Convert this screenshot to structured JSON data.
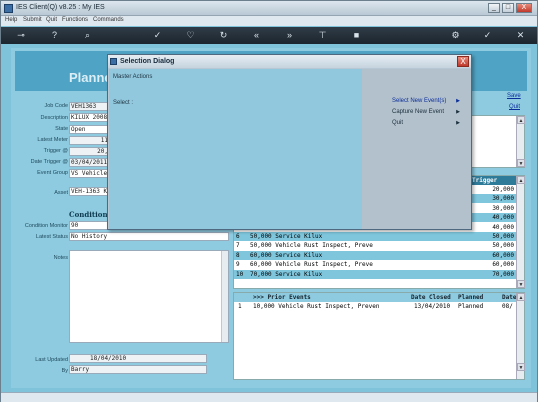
{
  "window": {
    "title": "IES Client(Q) v8.25 : My IES",
    "min": "_",
    "max": "□",
    "close": "X"
  },
  "menu": [
    "Help",
    "Submit",
    "Quit",
    "Functions",
    "Commands"
  ],
  "page": {
    "title": "Planne",
    "save_link": "Save",
    "quit_link": "Quit",
    "fields": {
      "job_code_label": "Job Code",
      "job_code": "VEH1363",
      "description_label": "Description",
      "description": "KILUX 2008",
      "state_label": "State",
      "state": "Open",
      "latest_meter_label": "Latest Meter",
      "latest_meter": "11",
      "trigger_label": "Trigger @",
      "trigger": "20,",
      "date_trigger_label": "Date Trigger @",
      "date_trigger": "03/04/2011",
      "event_group_label": "Event Group",
      "event_group": "VS Vehicle",
      "asset_label": "Asset",
      "asset": "VEH-1363 K",
      "condition_section": "Condition M",
      "condition_monitor_label": "Condition Monitor",
      "condition_monitor": "90",
      "latest_status_label": "Latest Status",
      "latest_status": "No History",
      "notes_label": "Notes",
      "last_updated_label": "Last Updated",
      "last_updated": "18/04/2010",
      "by_label": "By",
      "by": "Barry"
    }
  },
  "planned_grid": {
    "trigger_header": "Trigger",
    "rows": [
      {
        "n": "",
        "event": "",
        "trigger": "20,000"
      },
      {
        "n": "",
        "event": "",
        "trigger": "30,000"
      },
      {
        "n": "",
        "event": "",
        "trigger": "30,000"
      },
      {
        "n": "",
        "event": "",
        "trigger": "40,000"
      },
      {
        "n": "",
        "event": "",
        "trigger": "40,000"
      },
      {
        "n": "6",
        "event": "50,000 Service Kilux",
        "trigger": "50,000"
      },
      {
        "n": "7",
        "event": "50,000 Vehicle Rust Inspect, Preve",
        "trigger": "50,000"
      },
      {
        "n": "8",
        "event": "60,000 Service Kilux",
        "trigger": "60,000"
      },
      {
        "n": "9",
        "event": "60,000 Vehicle Rust Inspect, Preve",
        "trigger": "60,000"
      },
      {
        "n": "10",
        "event": "70,000 Service Kilux",
        "trigger": "70,000"
      }
    ]
  },
  "prior_grid": {
    "headers": {
      "events": ">>> Prior Events",
      "date_closed": "Date Closed",
      "planned": "Planned",
      "date": "Date"
    },
    "rows": [
      {
        "n": "1",
        "event": "10,000 Vehicle Rust Inspect, Preven",
        "date_closed": "13/04/2010",
        "planned": "Planned",
        "date": "08/"
      }
    ]
  },
  "dialog": {
    "title": "Selection Dialog",
    "close": "X",
    "master_actions": "Master Actions",
    "select_label": "Select :",
    "items": [
      {
        "label": "Select New Event(s)",
        "chev": "▶"
      },
      {
        "label": "Capture New Event",
        "chev": "▶"
      },
      {
        "label": "Quit",
        "chev": "▶"
      }
    ]
  }
}
